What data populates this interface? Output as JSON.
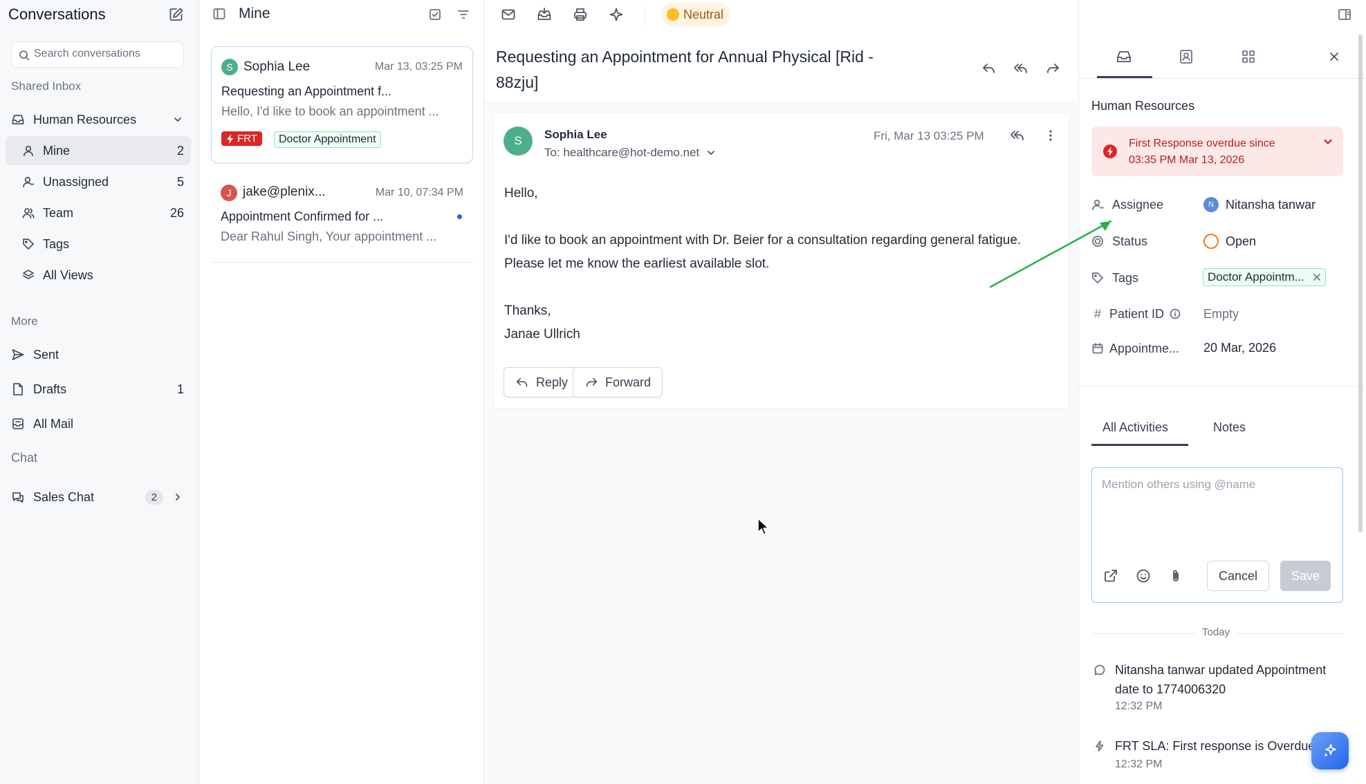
{
  "sidebar": {
    "title": "Conversations",
    "search_placeholder": "Search conversations",
    "shared_inbox_label": "Shared Inbox",
    "inbox_name": "Human Resources",
    "items": [
      {
        "label": "Mine",
        "count": "2"
      },
      {
        "label": "Unassigned",
        "count": "5"
      },
      {
        "label": "Team",
        "count": "26"
      },
      {
        "label": "Tags"
      },
      {
        "label": "All Views"
      }
    ],
    "more_label": "More",
    "more_items": [
      {
        "label": "Sent"
      },
      {
        "label": "Drafts",
        "count": "1"
      },
      {
        "label": "All Mail"
      }
    ],
    "chat_label": "Chat",
    "chat_items": [
      {
        "label": "Sales Chat",
        "count": "2"
      }
    ]
  },
  "conv_list": {
    "title": "Mine",
    "conversations": [
      {
        "avatar": "S",
        "avatar_color": "#4caf8a",
        "name": "Sophia Lee",
        "date": "Mar 13, 03:25 PM",
        "subject": "Requesting an Appointment f...",
        "preview": "Hello, I'd like to book an appointment ...",
        "tags": [
          "FRT",
          "Doctor Appointment"
        ]
      },
      {
        "avatar": "J",
        "avatar_color": "#d9534f",
        "name": "jake@plenix...",
        "date": "Mar 10, 07:34 PM",
        "subject": "Appointment Confirmed for ...",
        "preview": "Dear Rahul Singh, Your appointment ...",
        "unread": true
      }
    ]
  },
  "toolbar": {
    "sentiment": "Neutral"
  },
  "message": {
    "subject": "Requesting an Appointment for Annual Physical [Rid - 88zju]",
    "avatar": "S",
    "from": "Sophia Lee",
    "to": "To: healthcare@hot-demo.net",
    "date": "Fri, Mar 13 03:25 PM",
    "body": [
      "Hello,",
      "",
      "I'd like to book an appointment with Dr. Beier for a consultation regarding general fatigue. Please let me know the earliest available slot.",
      "",
      "Thanks,",
      "Janae Ullrich"
    ],
    "reply_label": "Reply",
    "forward_label": "Forward"
  },
  "details": {
    "team": "Human Resources",
    "overdue_line1": "First Response overdue since",
    "overdue_line2": "03:35 PM Mar 13, 2026",
    "assignee_label": "Assignee",
    "assignee_avatar": "N",
    "assignee_value": "Nitansha tanwar",
    "status_label": "Status",
    "status_value": "Open",
    "tags_label": "Tags",
    "tag_value": "Doctor Appointm...",
    "patient_label": "Patient ID",
    "patient_value": "Empty",
    "appt_label": "Appointme...",
    "appt_value": "20 Mar, 2026"
  },
  "activities": {
    "tab_all": "All Activities",
    "tab_notes": "Notes",
    "note_placeholder": "Mention others using @name",
    "cancel_label": "Cancel",
    "save_label": "Save",
    "today_label": "Today",
    "items": [
      {
        "text": "Nitansha tanwar updated Appointment date to 1774006320",
        "time": "12:32 PM"
      },
      {
        "text": "FRT SLA: First response is Overdue",
        "time": "12:32 PM"
      }
    ]
  },
  "colors": {
    "accent_blue": "#2563eb",
    "frt_red": "#dc2626",
    "overdue_bg": "#fde8e8",
    "annotation_arrow": "#22b14c"
  }
}
